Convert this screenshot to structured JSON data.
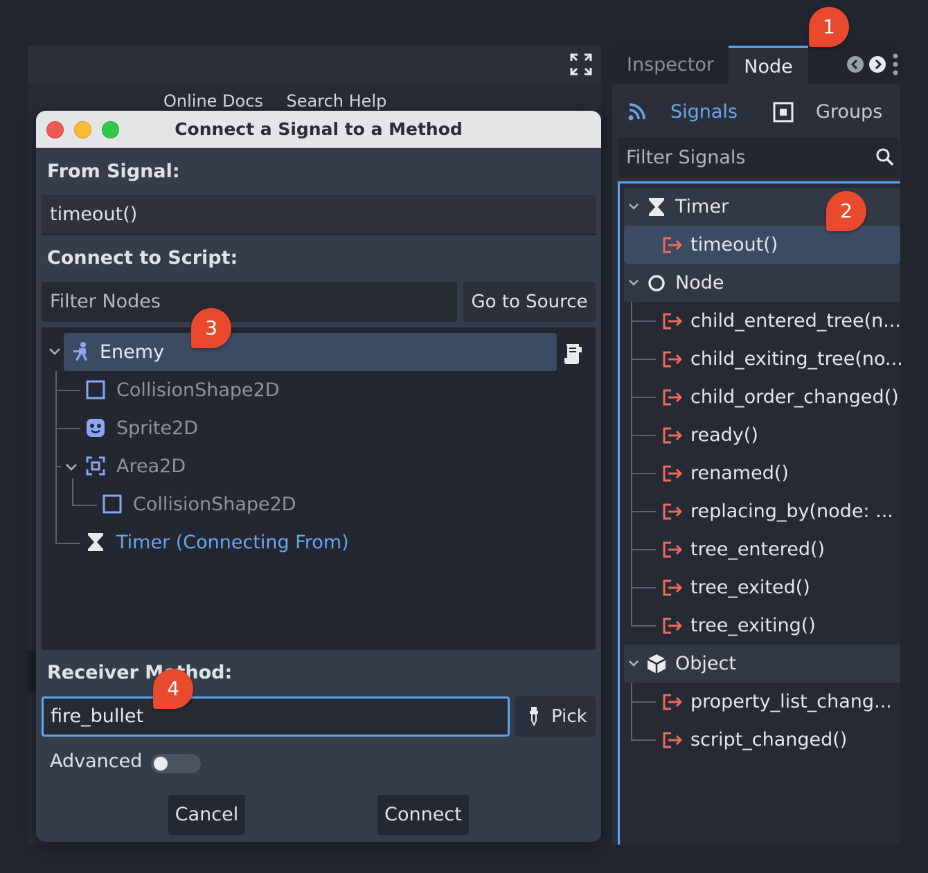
{
  "editor": {
    "doc_bar": {
      "online_docs_label": "Online Docs",
      "search_help_label": "Search Help"
    }
  },
  "dialog": {
    "title": "Connect a Signal to a Method",
    "from_signal_label": "From Signal:",
    "from_signal_value": "timeout()",
    "connect_to_script_label": "Connect to Script:",
    "filter_nodes_placeholder": "Filter Nodes",
    "go_to_source_label": "Go to Source",
    "node_tree": {
      "enemy": "Enemy",
      "collision_shape_1": "CollisionShape2D",
      "sprite": "Sprite2D",
      "area": "Area2D",
      "collision_shape_2": "CollisionShape2D",
      "timer": "Timer (Connecting From)"
    },
    "receiver_method_label": "Receiver Method:",
    "receiver_method_value": "fire_bullet",
    "pick_label": "Pick",
    "advanced_label": "Advanced",
    "advanced_enabled": false,
    "cancel_label": "Cancel",
    "connect_label": "Connect"
  },
  "dock": {
    "tabs": [
      {
        "label": "Inspector",
        "active": false
      },
      {
        "label": "Node",
        "active": true
      }
    ],
    "signals_tab_label": "Signals",
    "groups_tab_label": "Groups",
    "filter_signals_placeholder": "Filter Signals",
    "sections": [
      {
        "label": "Timer",
        "icon": "hourglass-icon",
        "signals": [
          "timeout()"
        ]
      },
      {
        "label": "Node",
        "icon": "circle-node-icon",
        "signals": [
          "child_entered_tree(n...",
          "child_exiting_tree(no...",
          "child_order_changed()",
          "ready()",
          "renamed()",
          "replacing_by(node: ...",
          "tree_entered()",
          "tree_exited()",
          "tree_exiting()"
        ]
      },
      {
        "label": "Object",
        "icon": "cube-icon",
        "signals": [
          "property_list_chang...",
          "script_changed()"
        ]
      }
    ]
  },
  "markers": [
    "1",
    "2",
    "3",
    "4"
  ],
  "colors": {
    "accent": "#5ba6f0",
    "signal": "#f06a5a",
    "marker": "#e94a2e",
    "node_icon": "#8da5f3"
  }
}
